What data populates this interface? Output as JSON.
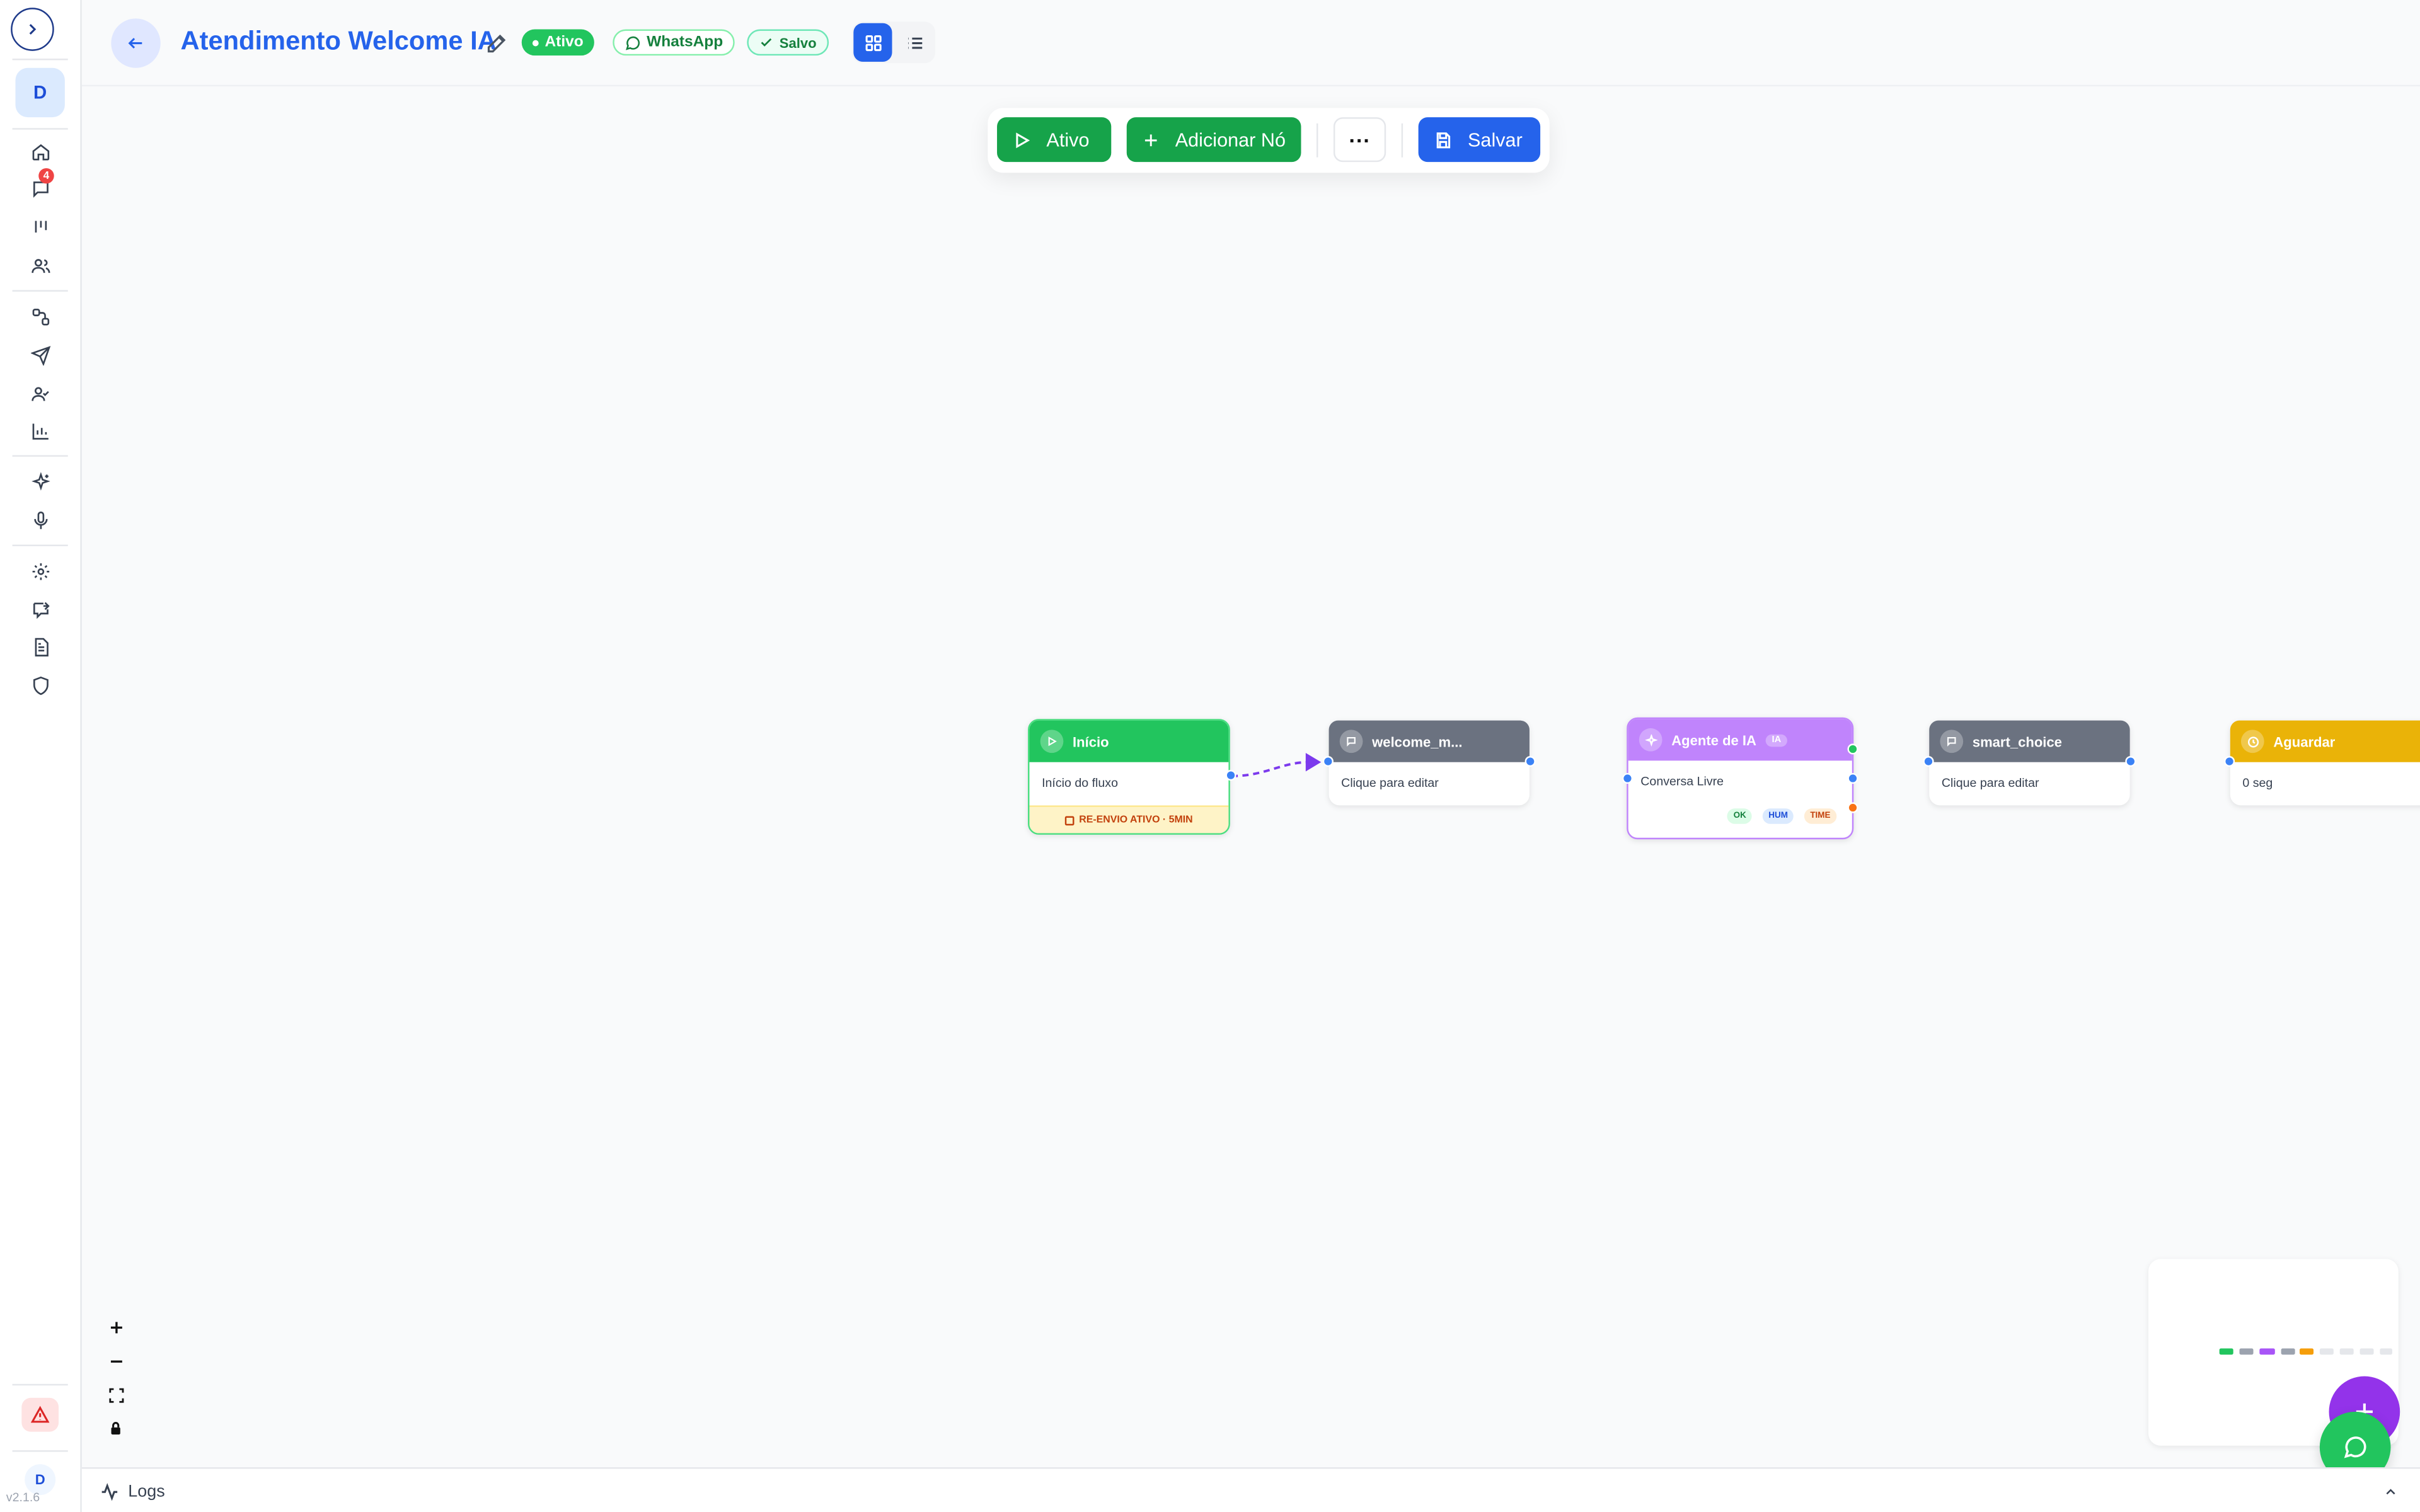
{
  "sidebar": {
    "avatar_initial": "D",
    "chat_badge": "4",
    "user_initial": "D",
    "version": "v2.1.6"
  },
  "header": {
    "title": "Atendimento Welcome IA",
    "status": "Ativo",
    "channel": "WhatsApp",
    "saved": "Salvo"
  },
  "toolbar": {
    "ativo": "Ativo",
    "add_node": "Adicionar Nó",
    "more": "···",
    "save": "Salvar"
  },
  "nodes": {
    "inicio": {
      "title": "Início",
      "body": "Início do fluxo",
      "footer": "RE-ENVIO ATIVO · 5MIN"
    },
    "welcome": {
      "title": "welcome_m...",
      "body": "Clique para editar"
    },
    "agente": {
      "title": "Agente de IA",
      "tag": "IA",
      "body": "Conversa Livre",
      "tags": [
        "OK",
        "HUM",
        "TIME"
      ]
    },
    "smart": {
      "title": "smart_choice",
      "body": "Clique para editar"
    },
    "aguardar": {
      "title": "Aguardar",
      "body": "0 seg"
    }
  },
  "logs": {
    "label": "Logs"
  },
  "colors": {
    "primary": "#2563eb",
    "success": "#16a34a",
    "ai": "#a855f7",
    "wait": "#eab308",
    "neutral_node": "#6b7280"
  }
}
